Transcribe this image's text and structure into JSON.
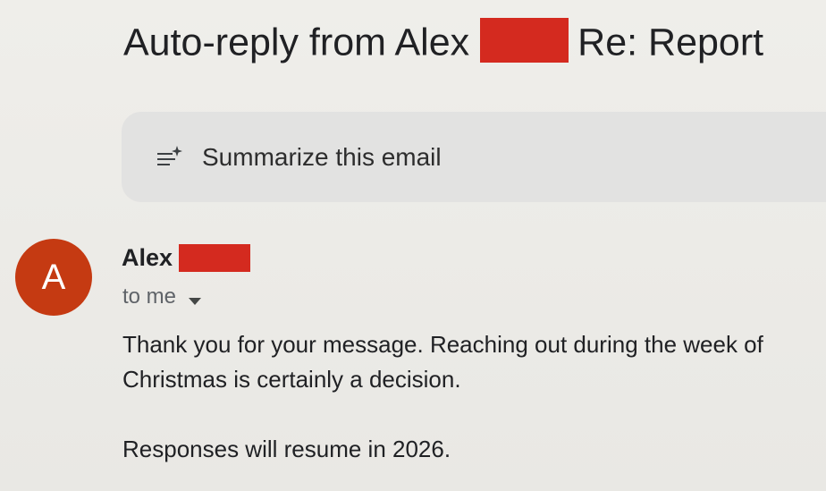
{
  "email": {
    "subject_prefix": "Auto-reply from Alex",
    "subject_suffix": "Re: Report",
    "summarize_label": "Summarize this email",
    "sender": {
      "avatar_letter": "A",
      "name": "Alex",
      "recipient": "to me"
    },
    "body": {
      "paragraph_1": "Thank you for your message. Reaching out during the week of Christmas is certainly a decision.",
      "paragraph_2": "Responses will resume in 2026."
    }
  },
  "colors": {
    "redaction": "#d42a1f",
    "avatar_bg": "#c53a12",
    "summarize_bar_bg": "#e2e2e1"
  },
  "icons": {
    "summarize": "summarize-sparkle-icon",
    "recipient_dropdown": "caret-down-icon"
  }
}
